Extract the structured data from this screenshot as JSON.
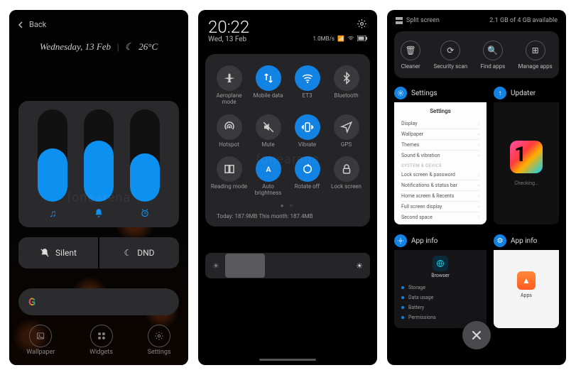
{
  "screen1": {
    "back": "Back",
    "date": "Wednesday, 13 Feb",
    "temp": "26°C",
    "volume_fill": [
      58,
      66,
      52
    ],
    "modes": {
      "silent": "Silent",
      "dnd": "DND"
    },
    "dock": {
      "wallpaper": "Wallpaper",
      "widgets": "Widgets",
      "settings": "Settings"
    },
    "watermark": "fonearena"
  },
  "screen2": {
    "time": "20:22",
    "date": "Wed, 13 Feb",
    "speed": "1.0MB/s",
    "toggles": [
      {
        "icon": "airplane",
        "label": "Aeroplane mode",
        "on": false
      },
      {
        "icon": "data",
        "label": "Mobile data",
        "on": true
      },
      {
        "icon": "wifi",
        "label": "ET3",
        "on": true
      },
      {
        "icon": "bt",
        "label": "Bluetooth",
        "on": false
      },
      {
        "icon": "hotspot",
        "label": "Hotspot",
        "on": false
      },
      {
        "icon": "mute",
        "label": "Mute",
        "on": false
      },
      {
        "icon": "vibrate",
        "label": "Vibrate",
        "on": true
      },
      {
        "icon": "gps",
        "label": "GPS",
        "on": false
      },
      {
        "icon": "reading",
        "label": "Reading mode",
        "on": false
      },
      {
        "icon": "autobright",
        "label": "Auto brightness",
        "on": true
      },
      {
        "icon": "rotate",
        "label": "Rotate off",
        "on": true
      },
      {
        "icon": "lock",
        "label": "Lock screen",
        "on": false
      }
    ],
    "usage": "Today: 187.9MB    This month: 187.4MB",
    "watermark": "fonearena"
  },
  "screen3": {
    "split": "Split screen",
    "storage": "2.1 GB of 4 GB available",
    "actions": [
      {
        "icon": "trash",
        "label": "Cleaner"
      },
      {
        "icon": "scan",
        "label": "Security scan"
      },
      {
        "icon": "search",
        "label": "Find apps"
      },
      {
        "icon": "grid",
        "label": "Manage apps"
      }
    ],
    "cards": {
      "settings": {
        "title": "Settings",
        "heading": "Settings",
        "rows": [
          "Display",
          "Wallpaper",
          "Themes",
          "Sound & vibration"
        ],
        "section": "SYSTEM & DEVICE",
        "rows2": [
          "Lock screen & password",
          "Notifications & status bar",
          "Home screen & Recents",
          "Full screen display",
          "Second space"
        ]
      },
      "updater": {
        "title": "Updater",
        "status": "Checking…"
      },
      "appinfo": {
        "title": "App info",
        "app": "Browser",
        "rows": [
          "Storage",
          "Data usage",
          "Battery",
          "Permissions"
        ]
      },
      "appinfo2": {
        "title": "App info",
        "app": "Apps"
      }
    }
  }
}
